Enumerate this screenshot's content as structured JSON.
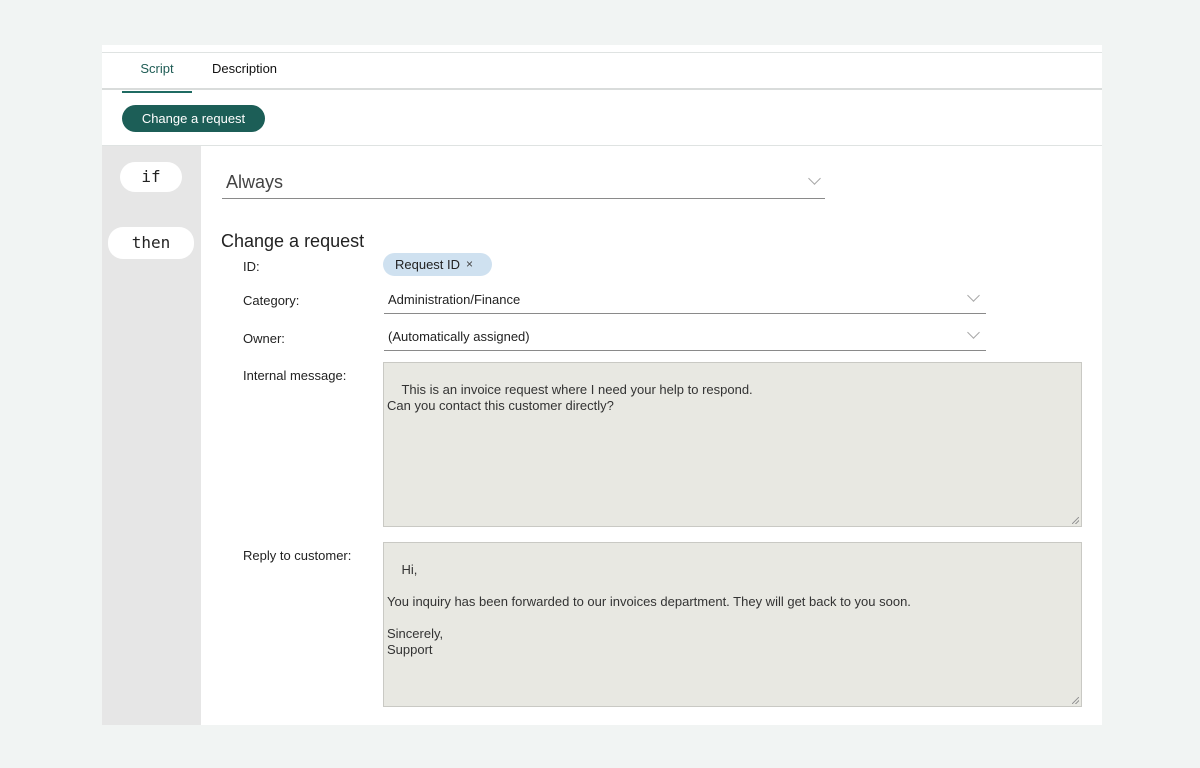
{
  "tabs": [
    {
      "label": "Script",
      "active": true
    },
    {
      "label": "Description",
      "active": false
    }
  ],
  "toolbar": {
    "action_button_label": "Change a request"
  },
  "rule": {
    "if_keyword": "if",
    "then_keyword": "then",
    "condition": {
      "value": "Always",
      "icon": "chevron-down-icon"
    }
  },
  "action": {
    "title": "Change a request",
    "fields": {
      "id": {
        "label": "ID:",
        "chip_label": "Request ID",
        "chip_remove": "×"
      },
      "category": {
        "label": "Category:",
        "value": "Administration/Finance",
        "icon": "chevron-down-icon"
      },
      "owner": {
        "label": "Owner:",
        "value": "(Automatically assigned)",
        "icon": "chevron-down-icon"
      },
      "internal_message": {
        "label": "Internal message:",
        "value": "This is an invoice request where I need your help to respond.\nCan you contact this customer directly?"
      },
      "reply": {
        "label": "Reply to customer:",
        "value": "Hi,\n\nYou inquiry has been forwarded to our invoices department. They will get back to you soon.\n\nSincerely,\nSupport"
      }
    }
  },
  "colors": {
    "accent": "#1c5e57",
    "chip": "#cfe1f0",
    "textarea_bg": "#e8e8e2",
    "gutter": "#e6e6e6",
    "page_bg": "#f1f4f3"
  }
}
